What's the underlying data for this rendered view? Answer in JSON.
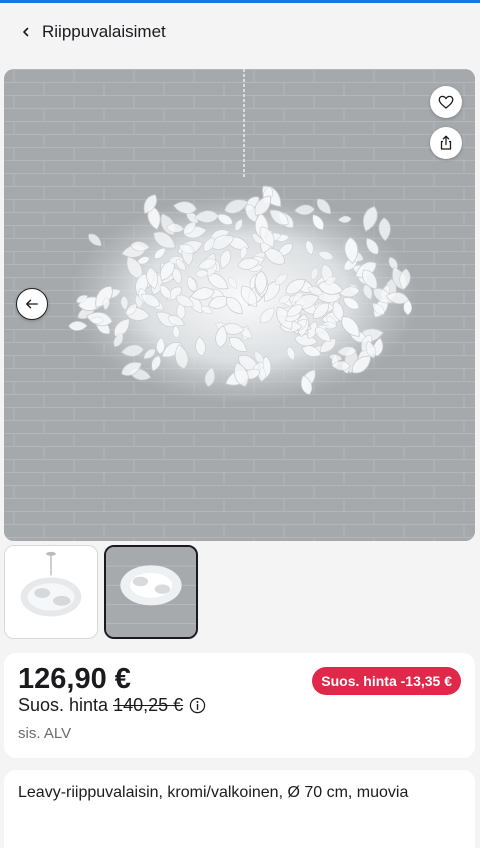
{
  "header": {
    "title": "Riippuvalaisimet"
  },
  "gallery": {
    "thumbnail_count": 2,
    "active_index": 1
  },
  "price": {
    "current": "126,90 €",
    "recommended_label": "Suos. hinta",
    "recommended_old": "140,25 €",
    "vat_note": "sis. ALV",
    "discount_badge": "Suos. hinta -13,35 €"
  },
  "description": {
    "text": "Leavy-riippuvalaisin, kromi/valkoinen, Ø 70 cm, muovia"
  },
  "colors": {
    "accent": "#1a73e8",
    "discount": "#e0284a",
    "background": "#f4f4f5"
  },
  "icons": {
    "back": "chevron-left-icon",
    "favorite": "heart-icon",
    "share": "share-icon",
    "previous": "arrow-left-icon",
    "info": "info-icon"
  }
}
